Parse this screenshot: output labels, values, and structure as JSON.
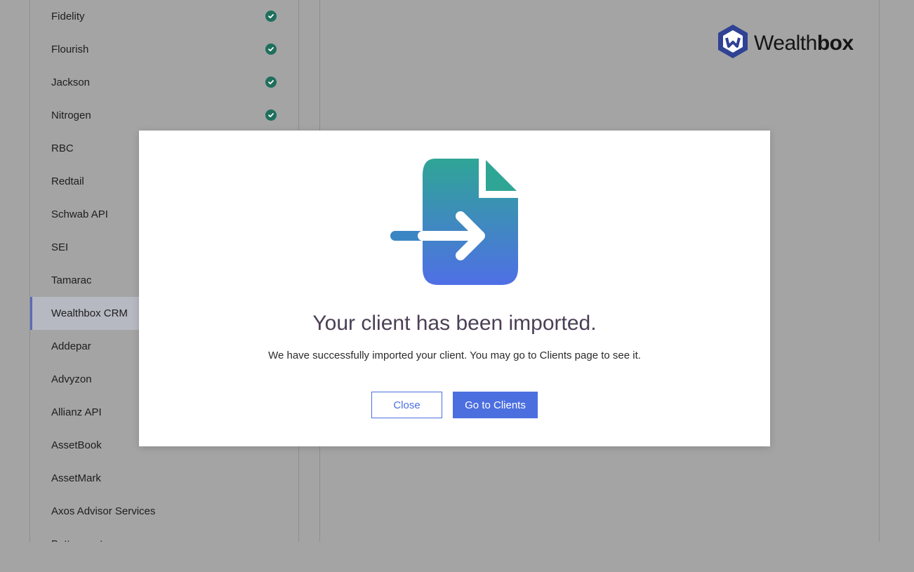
{
  "sidebar": {
    "items": [
      {
        "label": "Fidelity",
        "checked": true
      },
      {
        "label": "Flourish",
        "checked": true
      },
      {
        "label": "Jackson",
        "checked": true
      },
      {
        "label": "Nitrogen",
        "checked": true
      },
      {
        "label": "RBC",
        "checked": false
      },
      {
        "label": "Redtail",
        "checked": false
      },
      {
        "label": "Schwab API",
        "checked": false
      },
      {
        "label": "SEI",
        "checked": false
      },
      {
        "label": "Tamarac",
        "checked": false
      },
      {
        "label": "Wealthbox CRM",
        "checked": false,
        "active": true
      },
      {
        "label": "Addepar",
        "checked": false
      },
      {
        "label": "Advyzon",
        "checked": false
      },
      {
        "label": "Allianz API",
        "checked": false
      },
      {
        "label": "AssetBook",
        "checked": false
      },
      {
        "label": "AssetMark",
        "checked": false
      },
      {
        "label": "Axos Advisor Services",
        "checked": false
      },
      {
        "label": "Betterment",
        "checked": false
      }
    ]
  },
  "header": {
    "logo": {
      "text_light": "Wealth",
      "text_bold": "box",
      "icon": "wealthbox-hexagon-icon"
    }
  },
  "modal": {
    "icon": "file-import-icon",
    "title": "Your client has been imported.",
    "message": "We have successfully imported your client. You may go to Clients page to see it.",
    "close_label": "Close",
    "go_label": "Go to Clients"
  },
  "colors": {
    "accent": "#4c6fe0",
    "check": "#1f6f5d",
    "title": "#4b3f55",
    "icon_gradient_top": "#2fa596",
    "icon_gradient_bottom": "#4f6fe6"
  }
}
